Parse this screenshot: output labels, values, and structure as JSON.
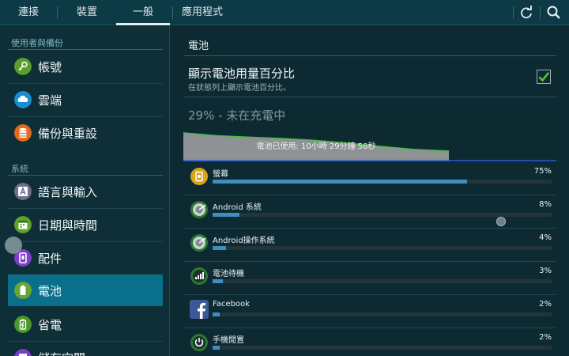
{
  "tabs": [
    {
      "label": "連接"
    },
    {
      "label": "裝置"
    },
    {
      "label": "一般"
    },
    {
      "label": "應用程式"
    }
  ],
  "toolbar": {
    "refresh_icon": "refresh-icon",
    "search_icon": "search-icon"
  },
  "sidebar": {
    "section_user": "使用者與備份",
    "section_system": "系統",
    "items": [
      {
        "label": "帳號",
        "icon": "key-icon",
        "color": "#5b9e2c"
      },
      {
        "label": "雲端",
        "icon": "cloud-icon",
        "color": "#1b8ed0"
      },
      {
        "label": "備份與重設",
        "icon": "database-icon",
        "color": "#e36a1b"
      },
      {
        "label": "語言與輸入",
        "icon": "language-icon",
        "color": "#6f6f8e"
      },
      {
        "label": "日期與時間",
        "icon": "calendar-icon",
        "color": "#5ea32c"
      },
      {
        "label": "配件",
        "icon": "accessory-icon",
        "color": "#7d3fc9"
      },
      {
        "label": "電池",
        "icon": "battery-icon",
        "color": "#69a630"
      },
      {
        "label": "省電",
        "icon": "power-saving-icon",
        "color": "#4a9a2a"
      },
      {
        "label": "儲存空間",
        "icon": "storage-icon",
        "color": "#7d3fc9"
      }
    ]
  },
  "battery": {
    "title": "電池",
    "show_percent_title": "顯示電池用量百分比",
    "show_percent_sub": "在狀態列上顯示電池百分比。",
    "show_percent_checked": true,
    "status": "29% - 未在充電中",
    "graph_label": "電池已使用: 10小時 29分鐘 58秒",
    "graph_level_fraction": [
      0.79,
      0.71,
      0.67,
      0.63,
      0.58,
      0.5,
      0.41,
      0.33,
      0.29
    ],
    "accent": "#3f8ec0",
    "usage": [
      {
        "name": "螢幕",
        "percent": "75%",
        "value": 75,
        "icon": "screen-icon"
      },
      {
        "name": "Android 系統",
        "percent": "8%",
        "value": 8,
        "icon": "android-system-icon"
      },
      {
        "name": "Android操作系統",
        "percent": "4%",
        "value": 4,
        "icon": "android-os-icon"
      },
      {
        "name": "電池待機",
        "percent": "3%",
        "value": 3,
        "icon": "cell-standby-icon"
      },
      {
        "name": "Facebook",
        "percent": "2%",
        "value": 2,
        "icon": "facebook-icon"
      },
      {
        "name": "手機閒置",
        "percent": "2%",
        "value": 2,
        "icon": "phone-idle-icon"
      }
    ]
  }
}
